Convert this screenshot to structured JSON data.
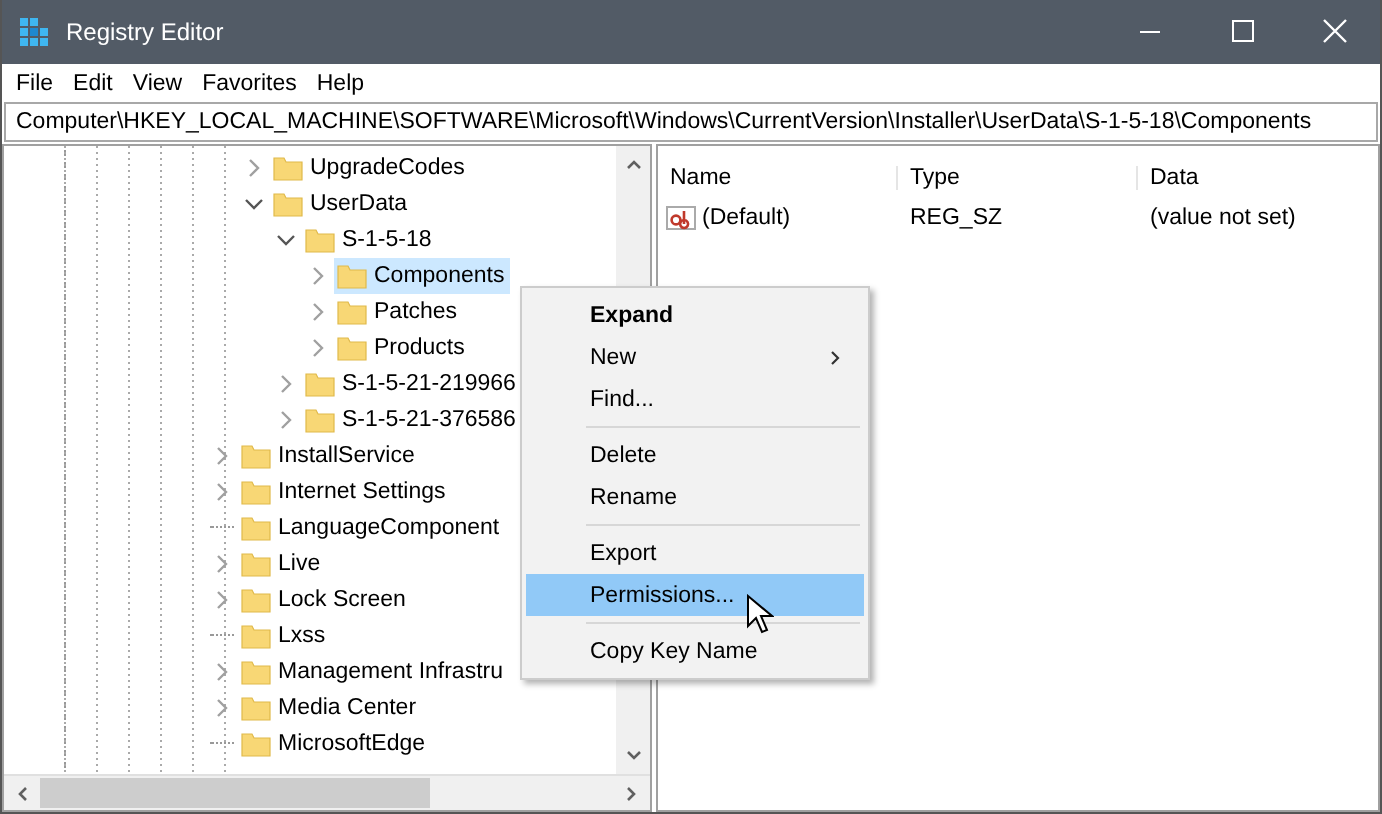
{
  "window": {
    "title": "Registry Editor"
  },
  "menu": [
    "File",
    "Edit",
    "View",
    "Favorites",
    "Help"
  ],
  "address": {
    "value": "Computer\\HKEY_LOCAL_MACHINE\\SOFTWARE\\Microsoft\\Windows\\CurrentVersion\\Installer\\UserData\\S-1-5-18\\Components"
  },
  "tree": {
    "items": [
      {
        "children": [
          {
            "label": "UpgradeCodes",
            "expandable": true,
            "expanded": false,
            "selected": false
          },
          {
            "label": "UserData",
            "expandable": true,
            "expanded": true,
            "selected": false,
            "children": [
              {
                "label": "S-1-5-18",
                "expandable": true,
                "expanded": true,
                "selected": false,
                "children": [
                  {
                    "label": "Components",
                    "expandable": true,
                    "expanded": false,
                    "selected": true
                  },
                  {
                    "label": "Patches",
                    "expandable": true,
                    "expanded": false,
                    "selected": false
                  },
                  {
                    "label": "Products",
                    "expandable": true,
                    "expanded": false,
                    "selected": false
                  }
                ]
              },
              {
                "label": "S-1-5-21-219966",
                "expandable": true,
                "expanded": false,
                "selected": false
              },
              {
                "label": "S-1-5-21-376586",
                "expandable": true,
                "expanded": false,
                "selected": false
              }
            ]
          }
        ]
      },
      {
        "label": "InstallService",
        "expandable": true,
        "expanded": false,
        "selected": false
      },
      {
        "label": "Internet Settings",
        "expandable": true,
        "expanded": false,
        "selected": false
      },
      {
        "label": "LanguageComponent",
        "expandable": false,
        "selected": false
      },
      {
        "label": "Live",
        "expandable": true,
        "expanded": false,
        "selected": false
      },
      {
        "label": "Lock Screen",
        "expandable": true,
        "expanded": false,
        "selected": false
      },
      {
        "label": "Lxss",
        "expandable": false,
        "selected": false
      },
      {
        "label": "Management Infrastru",
        "expandable": true,
        "expanded": false,
        "selected": false
      },
      {
        "label": "Media Center",
        "expandable": true,
        "expanded": false,
        "selected": false
      },
      {
        "label": "MicrosoftEdge",
        "expandable": false,
        "selected": false
      }
    ]
  },
  "values": {
    "columns": [
      "Name",
      "Type",
      "Data"
    ],
    "rows": [
      {
        "name": "(Default)",
        "type": "REG_SZ",
        "data": "(value not set)"
      }
    ]
  },
  "context_menu": {
    "items": [
      {
        "kind": "item",
        "label": "Expand",
        "default": true,
        "submenu": false,
        "selected": false
      },
      {
        "kind": "item",
        "label": "New",
        "default": false,
        "submenu": true,
        "selected": false
      },
      {
        "kind": "item",
        "label": "Find...",
        "default": false,
        "submenu": false,
        "selected": false
      },
      {
        "kind": "separator"
      },
      {
        "kind": "item",
        "label": "Delete",
        "default": false,
        "submenu": false,
        "selected": false
      },
      {
        "kind": "item",
        "label": "Rename",
        "default": false,
        "submenu": false,
        "selected": false
      },
      {
        "kind": "separator"
      },
      {
        "kind": "item",
        "label": "Export",
        "default": false,
        "submenu": false,
        "selected": false
      },
      {
        "kind": "item",
        "label": "Permissions...",
        "default": false,
        "submenu": false,
        "selected": true
      },
      {
        "kind": "separator"
      },
      {
        "kind": "item",
        "label": "Copy Key Name",
        "default": false,
        "submenu": false,
        "selected": false
      }
    ]
  }
}
